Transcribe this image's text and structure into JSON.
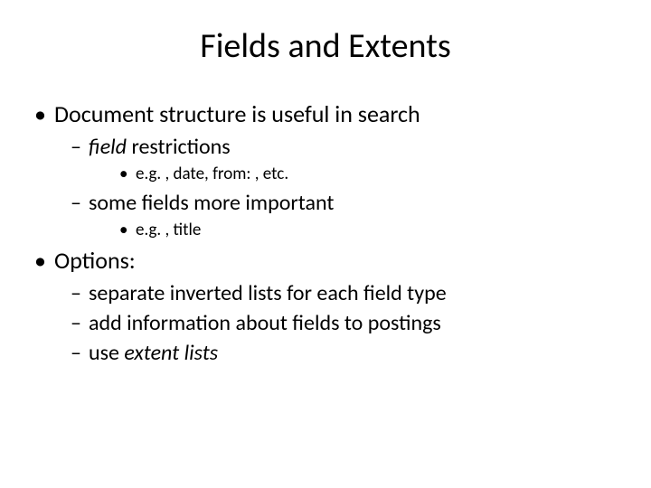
{
  "title": "Fields and Extents",
  "b1": {
    "text": "Document structure is useful in search",
    "s1": {
      "italic": "field",
      "text": " restrictions",
      "e1": "e.g. , date, from: , etc."
    },
    "s2": {
      "text": "some fields more important",
      "e1": "e.g. , title"
    }
  },
  "b2": {
    "text": "Options:",
    "s1": {
      "text": "separate inverted lists for each field type"
    },
    "s2": {
      "text": "add information about fields to postings"
    },
    "s3": {
      "pre": "use ",
      "italic": "extent lists"
    }
  }
}
